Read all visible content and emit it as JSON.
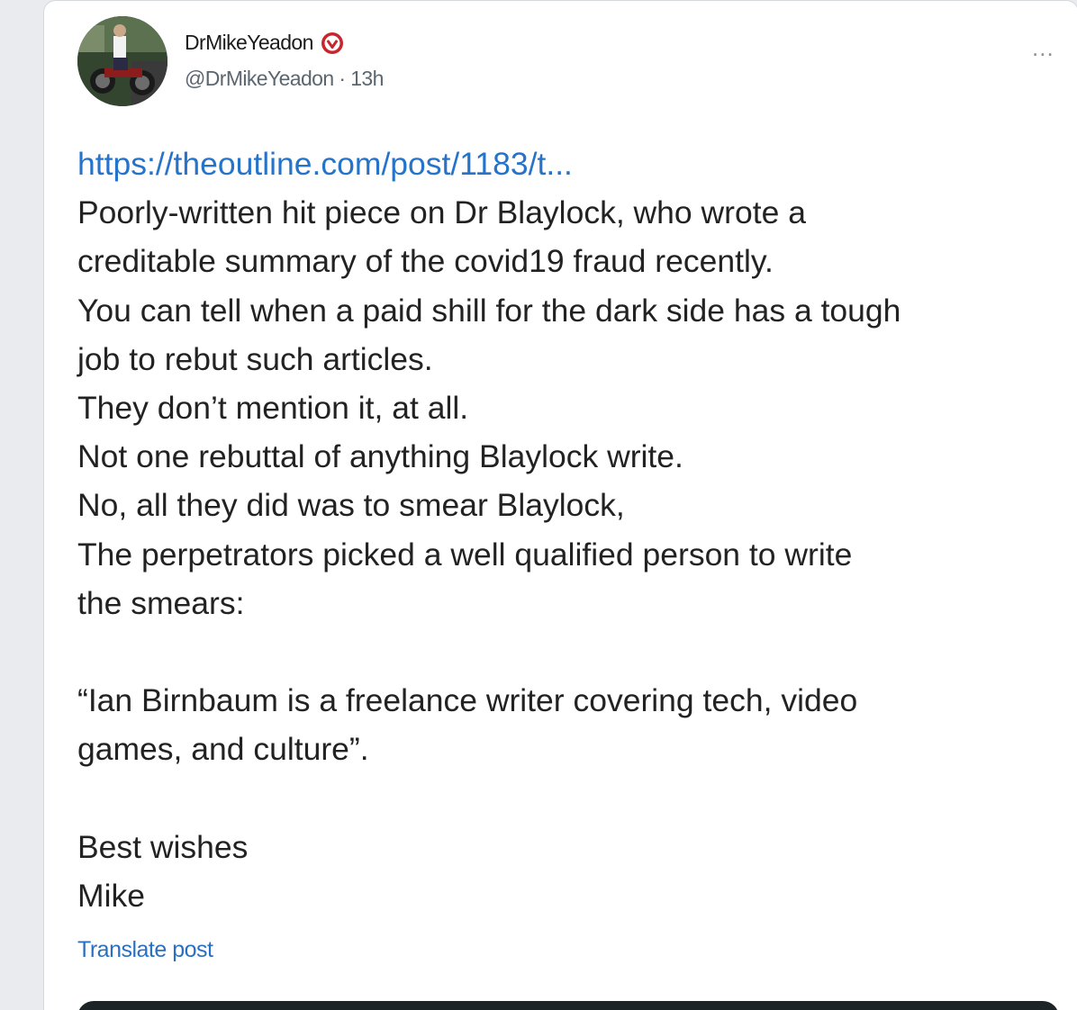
{
  "author": {
    "display_name": "DrMikeYeadon",
    "handle": "@DrMikeYeadon",
    "separator": " · ",
    "time_ago": "13h",
    "verified_icon": "verified-badge-icon",
    "avatar": "motorcycle-avatar"
  },
  "post": {
    "link": "https://theoutline.com/post/1183/t...",
    "lines": [
      "Poorly-written hit piece on Dr Blaylock, who wrote a",
      "creditable summary of the covid19 fraud recently.",
      "You can tell when a paid shill for the dark side has a tough",
      "job to rebut such articles.",
      "They don’t mention it, at all.",
      "Not one rebuttal of anything Blaylock write.",
      "No, all they did was to smear Blaylock,",
      "The perpetrators picked a well qualified person to write",
      "the smears:",
      "",
      "“Ian Birnbaum is a freelance writer covering tech, video",
      "games, and culture”.",
      "",
      "Best wishes",
      "Mike"
    ]
  },
  "actions": {
    "more_label": "...",
    "translate_label": "Translate post"
  },
  "colors": {
    "link": "#2574c9",
    "text": "#222222",
    "muted": "#5b6670",
    "verified": "#c8262e"
  }
}
